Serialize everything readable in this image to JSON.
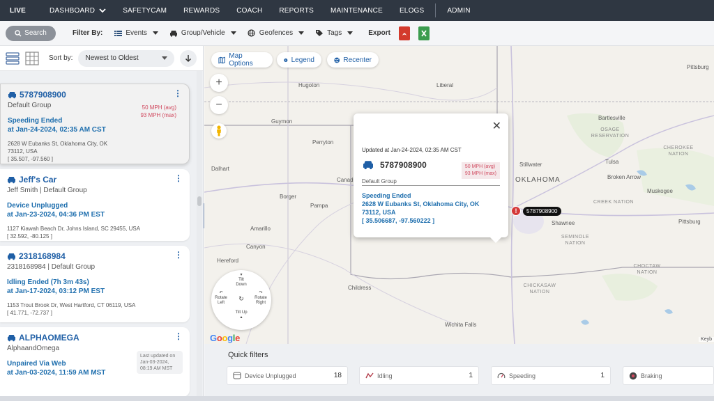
{
  "nav": {
    "items": [
      "LIVE",
      "DASHBOARD",
      "SAFETYCAM",
      "REWARDS",
      "COACH",
      "REPORTS",
      "MAINTENANCE",
      "ELOGS",
      "ADMIN"
    ]
  },
  "filterbar": {
    "search_label": "Search",
    "filter_by_label": "Filter By:",
    "events_label": "Events",
    "group_label": "Group/Vehicle",
    "geofences_label": "Geofences",
    "tags_label": "Tags",
    "export_label": "Export"
  },
  "sort": {
    "label": "Sort by:",
    "selected": "Newest to Oldest"
  },
  "vehicles": [
    {
      "name": "5787908900",
      "group": "Default Group",
      "speed_avg": "50 MPH (avg)",
      "speed_max": "93 MPH (max)",
      "event": "Speeding Ended",
      "event_time": "at Jan-24-2024, 02:35 AM CST",
      "address1": "2628 W Eubanks St, Oklahoma City, OK",
      "address2": "73112, USA",
      "coords": "[ 35.507, -97.560 ]"
    },
    {
      "name": "Jeff's Car",
      "group": "Jeff Smith |  Default Group",
      "event": "Device Unplugged",
      "event_time": "at Jan-23-2024, 04:36 PM EST",
      "address1": "1127 Kiawah Beach Dr, Johns Island, SC 29455, USA",
      "coords": "[ 32.592, -80.125 ]"
    },
    {
      "name": "2318168984",
      "group": "2318168984  |  Default Group",
      "event": "Idling Ended (7h 3m 43s)",
      "event_time": "at Jan-17-2024, 03:12 PM EST",
      "address1": "1153 Trout Brook Dr, West Hartford, CT 06119, USA",
      "coords": "[ 41.771, -72.737 ]"
    },
    {
      "name": "ALPHAOMEGA",
      "group": "AlphaandOmega",
      "last_updated": "Last updated on Jan-03-2024, 08:19 AM MST",
      "event": "Unpaired Via Web",
      "event_time": "at Jan-03-2024, 11:59 AM MST"
    }
  ],
  "map": {
    "map_options_label": "Map Options",
    "legend_label": "Legend",
    "recenter_label": "Recenter",
    "zoom_in": "+",
    "zoom_out": "−",
    "rotate": {
      "tilt_down": "Tilt Down",
      "rotate_left": "Rotate Left",
      "rotate_right": "Rotate Right",
      "tilt_up": "Tilt Up"
    },
    "google_logo": "Google",
    "attribution": "Keyb",
    "marker_label": "5787908900",
    "places": [
      "Hugoton",
      "Guymon",
      "Perryton",
      "Dalhart",
      "Canad",
      "Borger",
      "Pampa",
      "Amarillo",
      "Canyon",
      "Hereford",
      "Childress",
      "Wichita Falls",
      "Liberal",
      "Pittsburg",
      "Bartlesville",
      "Stillwater",
      "Tulsa",
      "Broken Arrow",
      "Shawnee",
      "Muskogee",
      "Pittsburg"
    ],
    "state_label": "OKLAHOMA",
    "nations": [
      "OSAGE RESERVATION",
      "CHEROKEE NATION",
      "CREEK NATION",
      "SEMINOLE NATION",
      "CHICKASAW NATION",
      "CHOCTAW NATION"
    ],
    "popup": {
      "updated": "Updated at Jan-24-2024, 02:35 AM CST",
      "vehicle": "5787908900",
      "speed_avg": "50 MPH (avg)",
      "speed_max": "93 MPH (max)",
      "group": "Default Group",
      "event": "Speeding Ended",
      "address1": "2628 W Eubanks St, Oklahoma City, OK",
      "address2": "73112, USA",
      "coords": "[ 35.506687, -97.560222 ]"
    }
  },
  "quick_filters": {
    "title": "Quick filters",
    "items": [
      {
        "label": "Device Unplugged",
        "count": "18"
      },
      {
        "label": "Idling",
        "count": "1"
      },
      {
        "label": "Speeding",
        "count": "1"
      },
      {
        "label": "Braking",
        "count": ""
      }
    ]
  },
  "colors": {
    "nav_bg": "#2f3742",
    "accent_blue": "#1f5fa6",
    "speed_red": "#d0485e"
  }
}
